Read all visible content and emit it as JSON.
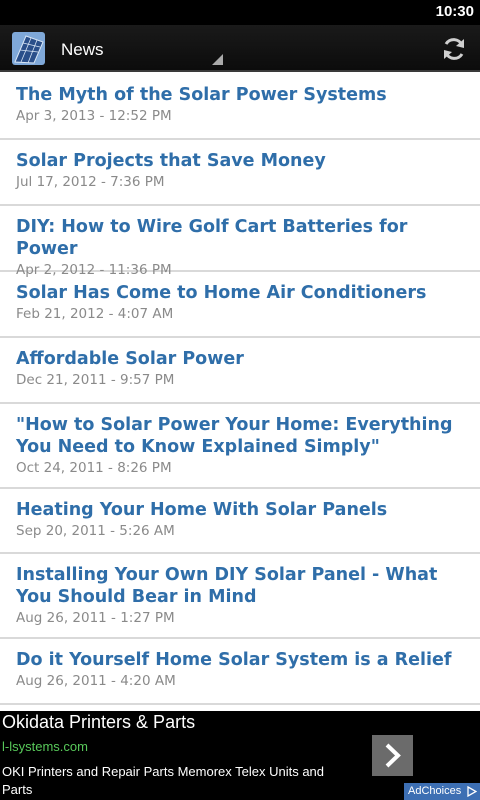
{
  "status_bar": {
    "time": "10:30"
  },
  "action_bar": {
    "title": "News"
  },
  "news": [
    {
      "title": "The Myth of the Solar Power Systems",
      "date": "Apr 3, 2013 - 12:52 PM"
    },
    {
      "title": "Solar Projects that Save Money",
      "date": "Jul 17, 2012 - 7:36 PM"
    },
    {
      "title": "DIY: How to Wire Golf Cart Batteries for Power",
      "date": "Apr 2, 2012 - 11:36 PM"
    },
    {
      "title": "Solar Has Come to Home Air Conditioners",
      "date": "Feb 21, 2012 - 4:07 AM"
    },
    {
      "title": "Affordable Solar Power",
      "date": "Dec 21, 2011 - 9:57 PM"
    },
    {
      "title": "\"How to Solar Power Your Home: Everything You Need to Know Explained Simply\"",
      "date": "Oct 24, 2011 - 8:26 PM"
    },
    {
      "title": "Heating Your Home With Solar Panels",
      "date": "Sep 20, 2011 - 5:26 AM"
    },
    {
      "title": "Installing Your Own DIY Solar Panel - What You Should Bear in Mind",
      "date": "Aug 26, 2011 - 1:27 PM"
    },
    {
      "title": "Do it Yourself Home Solar System is a Relief",
      "date": "Aug 26, 2011 - 4:20 AM"
    }
  ],
  "ad": {
    "title": "Okidata Printers & Parts",
    "url": "l-lsystems.com",
    "description": "OKI Printers and Repair Parts Memorex Telex Units and Parts",
    "adchoices_label": "AdChoices"
  },
  "icons": {
    "app": "solar-panel-icon",
    "refresh": "refresh-icon",
    "ad_arrow": "chevron-right-icon",
    "adchoices": "adchoices-icon"
  },
  "colors": {
    "title_blue": "#2f6ea9",
    "date_gray": "#8a8a8a",
    "ad_url_green": "#58c85a",
    "adchoices_blue": "#3d6fb3"
  }
}
